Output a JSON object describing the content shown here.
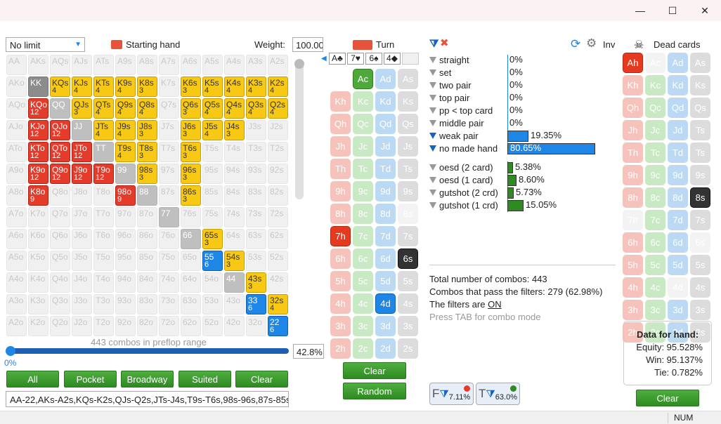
{
  "window": {
    "min": "—",
    "max": "☐",
    "close": "✕"
  },
  "range": {
    "mode_select": "No limit",
    "starting_hand": "Starting hand",
    "weight_label": "Weight:",
    "weight_value": "100.00",
    "combos_text": "443 combos in preflop range",
    "slider_left": "0%",
    "slider_right": "42.8%",
    "range_text": "AA-22,AKs-A2s,KQs-K2s,QJs-Q2s,JTs-J4s,T9s-T6s,98s-96s,87s-85s,7",
    "buttons": [
      "All",
      "Pocket",
      "Broadway",
      "Suited",
      "Clear"
    ]
  },
  "matrix": [
    [
      [
        "AA",
        "",
        "empty"
      ],
      [
        "AKs",
        "",
        "empty"
      ],
      [
        "AQs",
        "",
        "empty"
      ],
      [
        "AJs",
        "",
        "empty"
      ],
      [
        "ATs",
        "",
        "empty"
      ],
      [
        "A9s",
        "",
        "empty"
      ],
      [
        "A8s",
        "",
        "empty"
      ],
      [
        "A7s",
        "",
        "empty"
      ],
      [
        "A6s",
        "",
        "empty"
      ],
      [
        "A5s",
        "",
        "empty"
      ],
      [
        "A4s",
        "",
        "empty"
      ],
      [
        "A3s",
        "",
        "empty"
      ],
      [
        "A2s",
        "",
        "empty"
      ]
    ],
    [
      [
        "AKo",
        "",
        "empty"
      ],
      [
        "KK",
        "",
        "kk"
      ],
      [
        "KQs",
        "4",
        "yel"
      ],
      [
        "KJs",
        "4",
        "yel"
      ],
      [
        "KTs",
        "4",
        "yel"
      ],
      [
        "K9s",
        "4",
        "yel"
      ],
      [
        "K8s",
        "3",
        "yel"
      ],
      [
        "K7s",
        "",
        "empty"
      ],
      [
        "K6s",
        "3",
        "yel"
      ],
      [
        "K5s",
        "4",
        "yel"
      ],
      [
        "K4s",
        "4",
        "yel"
      ],
      [
        "K3s",
        "4",
        "yel"
      ],
      [
        "K2s",
        "4",
        "yel"
      ]
    ],
    [
      [
        "AQo",
        "",
        "empty"
      ],
      [
        "KQo",
        "12",
        "red"
      ],
      [
        "QQ",
        "",
        "pair"
      ],
      [
        "QJs",
        "3",
        "yel"
      ],
      [
        "QTs",
        "4",
        "yel"
      ],
      [
        "Q9s",
        "4",
        "yel"
      ],
      [
        "Q8s",
        "4",
        "yel"
      ],
      [
        "Q7s",
        "",
        "empty"
      ],
      [
        "Q6s",
        "3",
        "yel"
      ],
      [
        "Q5s",
        "4",
        "yel"
      ],
      [
        "Q4s",
        "4",
        "yel"
      ],
      [
        "Q3s",
        "4",
        "yel"
      ],
      [
        "Q2s",
        "4",
        "yel"
      ]
    ],
    [
      [
        "AJo",
        "",
        "empty"
      ],
      [
        "KJo",
        "12",
        "red"
      ],
      [
        "QJo",
        "12",
        "red"
      ],
      [
        "JJ",
        "",
        "pair"
      ],
      [
        "JTs",
        "4",
        "yel"
      ],
      [
        "J9s",
        "4",
        "yel"
      ],
      [
        "J8s",
        "3",
        "yel"
      ],
      [
        "J7s",
        "",
        "empty"
      ],
      [
        "J6s",
        "3",
        "yel"
      ],
      [
        "J5s",
        "4",
        "yel"
      ],
      [
        "J4s",
        "3",
        "yel"
      ],
      [
        "J3s",
        "",
        "empty"
      ],
      [
        "J2s",
        "",
        "empty"
      ]
    ],
    [
      [
        "ATo",
        "",
        "empty"
      ],
      [
        "KTo",
        "12",
        "red"
      ],
      [
        "QTo",
        "12",
        "red"
      ],
      [
        "JTo",
        "12",
        "red"
      ],
      [
        "TT",
        "",
        "pair"
      ],
      [
        "T9s",
        "4",
        "yel"
      ],
      [
        "T8s",
        "3",
        "yel"
      ],
      [
        "T7s",
        "",
        "empty"
      ],
      [
        "T6s",
        "3",
        "yel"
      ],
      [
        "T5s",
        "",
        "empty"
      ],
      [
        "T4s",
        "",
        "empty"
      ],
      [
        "T3s",
        "",
        "empty"
      ],
      [
        "T2s",
        "",
        "empty"
      ]
    ],
    [
      [
        "A9o",
        "",
        "empty"
      ],
      [
        "K9o",
        "12",
        "red"
      ],
      [
        "Q9o",
        "12",
        "red"
      ],
      [
        "J9o",
        "12",
        "red"
      ],
      [
        "T9o",
        "12",
        "red"
      ],
      [
        "99",
        "",
        "pair"
      ],
      [
        "98s",
        "3",
        "yel"
      ],
      [
        "97s",
        "",
        "empty"
      ],
      [
        "96s",
        "3",
        "yel"
      ],
      [
        "95s",
        "",
        "empty"
      ],
      [
        "94s",
        "",
        "empty"
      ],
      [
        "93s",
        "",
        "empty"
      ],
      [
        "92s",
        "",
        "empty"
      ]
    ],
    [
      [
        "A8o",
        "",
        "empty"
      ],
      [
        "K8o",
        "9",
        "red"
      ],
      [
        "Q8o",
        "",
        "empty"
      ],
      [
        "J8o",
        "",
        "empty"
      ],
      [
        "T8o",
        "",
        "empty"
      ],
      [
        "98o",
        "9",
        "red"
      ],
      [
        "88",
        "",
        "pair"
      ],
      [
        "87s",
        "",
        "empty"
      ],
      [
        "86s",
        "3",
        "yel"
      ],
      [
        "85s",
        "",
        "empty"
      ],
      [
        "84s",
        "",
        "empty"
      ],
      [
        "83s",
        "",
        "empty"
      ],
      [
        "82s",
        "",
        "empty"
      ]
    ],
    [
      [
        "A7o",
        "",
        "empty"
      ],
      [
        "K7o",
        "",
        "empty"
      ],
      [
        "Q7o",
        "",
        "empty"
      ],
      [
        "J7o",
        "",
        "empty"
      ],
      [
        "T7o",
        "",
        "empty"
      ],
      [
        "97o",
        "",
        "empty"
      ],
      [
        "87o",
        "",
        "empty"
      ],
      [
        "77",
        "",
        "pair"
      ],
      [
        "76s",
        "",
        "empty"
      ],
      [
        "75s",
        "",
        "empty"
      ],
      [
        "74s",
        "",
        "empty"
      ],
      [
        "73s",
        "",
        "empty"
      ],
      [
        "72s",
        "",
        "empty"
      ]
    ],
    [
      [
        "A6o",
        "",
        "empty"
      ],
      [
        "K6o",
        "",
        "empty"
      ],
      [
        "Q6o",
        "",
        "empty"
      ],
      [
        "J6o",
        "",
        "empty"
      ],
      [
        "T6o",
        "",
        "empty"
      ],
      [
        "96o",
        "",
        "empty"
      ],
      [
        "86o",
        "",
        "empty"
      ],
      [
        "76o",
        "",
        "empty"
      ],
      [
        "66",
        "",
        "pair"
      ],
      [
        "65s",
        "3",
        "yel"
      ],
      [
        "64s",
        "",
        "empty"
      ],
      [
        "63s",
        "",
        "empty"
      ],
      [
        "62s",
        "",
        "empty"
      ]
    ],
    [
      [
        "A5o",
        "",
        "empty"
      ],
      [
        "K5o",
        "",
        "empty"
      ],
      [
        "Q5o",
        "",
        "empty"
      ],
      [
        "J5o",
        "",
        "empty"
      ],
      [
        "T5o",
        "",
        "empty"
      ],
      [
        "95o",
        "",
        "empty"
      ],
      [
        "85o",
        "",
        "empty"
      ],
      [
        "75o",
        "",
        "empty"
      ],
      [
        "65o",
        "",
        "empty"
      ],
      [
        "55",
        "6",
        "blu"
      ],
      [
        "54s",
        "3",
        "yel"
      ],
      [
        "53s",
        "",
        "empty"
      ],
      [
        "52s",
        "",
        "empty"
      ]
    ],
    [
      [
        "A4o",
        "",
        "empty"
      ],
      [
        "K4o",
        "",
        "empty"
      ],
      [
        "Q4o",
        "",
        "empty"
      ],
      [
        "J4o",
        "",
        "empty"
      ],
      [
        "T4o",
        "",
        "empty"
      ],
      [
        "94o",
        "",
        "empty"
      ],
      [
        "84o",
        "",
        "empty"
      ],
      [
        "74o",
        "",
        "empty"
      ],
      [
        "64o",
        "",
        "empty"
      ],
      [
        "54o",
        "",
        "empty"
      ],
      [
        "44",
        "",
        "pair"
      ],
      [
        "43s",
        "3",
        "yel"
      ],
      [
        "42s",
        "",
        "empty"
      ]
    ],
    [
      [
        "A3o",
        "",
        "empty"
      ],
      [
        "K3o",
        "",
        "empty"
      ],
      [
        "Q3o",
        "",
        "empty"
      ],
      [
        "J3o",
        "",
        "empty"
      ],
      [
        "T3o",
        "",
        "empty"
      ],
      [
        "93o",
        "",
        "empty"
      ],
      [
        "83o",
        "",
        "empty"
      ],
      [
        "73o",
        "",
        "empty"
      ],
      [
        "63o",
        "",
        "empty"
      ],
      [
        "53o",
        "",
        "empty"
      ],
      [
        "43o",
        "",
        "empty"
      ],
      [
        "33",
        "6",
        "blu"
      ],
      [
        "32s",
        "4",
        "yel"
      ]
    ],
    [
      [
        "A2o",
        "",
        "empty"
      ],
      [
        "K2o",
        "",
        "empty"
      ],
      [
        "Q2o",
        "",
        "empty"
      ],
      [
        "J2o",
        "",
        "empty"
      ],
      [
        "T2o",
        "",
        "empty"
      ],
      [
        "92o",
        "",
        "empty"
      ],
      [
        "82o",
        "",
        "empty"
      ],
      [
        "72o",
        "",
        "empty"
      ],
      [
        "62o",
        "",
        "empty"
      ],
      [
        "52o",
        "",
        "empty"
      ],
      [
        "42o",
        "",
        "empty"
      ],
      [
        "32o",
        "",
        "empty"
      ],
      [
        "22",
        "6",
        "blu"
      ]
    ]
  ],
  "turn": {
    "label": "Turn",
    "board": [
      "A♣",
      "7♥",
      "6♠",
      "4◆"
    ],
    "clear": "Clear",
    "random": "Random",
    "cols": [
      [
        [
          "",
          "ghost"
        ],
        [
          "Kh",
          "h"
        ],
        [
          "Qh",
          "h"
        ],
        [
          "Jh",
          "h"
        ],
        [
          "Th",
          "h"
        ],
        [
          "9h",
          "h"
        ],
        [
          "8h",
          "h"
        ],
        [
          "7h",
          "sel-h"
        ],
        [
          "6h",
          "h"
        ],
        [
          "5h",
          "h"
        ],
        [
          "4h",
          "h"
        ],
        [
          "3h",
          "h"
        ],
        [
          "2h",
          "h"
        ]
      ],
      [
        [
          "Ac",
          "sel-c"
        ],
        [
          "Kc",
          "c"
        ],
        [
          "Qc",
          "c"
        ],
        [
          "Jc",
          "c"
        ],
        [
          "Tc",
          "c"
        ],
        [
          "9c",
          "c"
        ],
        [
          "8c",
          "c"
        ],
        [
          "7c",
          "c"
        ],
        [
          "6c",
          "c"
        ],
        [
          "5c",
          "c"
        ],
        [
          "4c",
          "c"
        ],
        [
          "3c",
          "c"
        ],
        [
          "2c",
          "c"
        ]
      ],
      [
        [
          "Ad",
          "d"
        ],
        [
          "Kd",
          "d"
        ],
        [
          "Qd",
          "d"
        ],
        [
          "Jd",
          "d"
        ],
        [
          "Td",
          "d"
        ],
        [
          "9d",
          "d"
        ],
        [
          "8d",
          "d"
        ],
        [
          "7d",
          "d"
        ],
        [
          "6d",
          "d"
        ],
        [
          "5d",
          "d"
        ],
        [
          "4d",
          "sel-d"
        ],
        [
          "3d",
          "d"
        ],
        [
          "2d",
          "d"
        ]
      ],
      [
        [
          "As",
          "s"
        ],
        [
          "Ks",
          "s"
        ],
        [
          "Qs",
          "s"
        ],
        [
          "Js",
          "s"
        ],
        [
          "Ts",
          "s"
        ],
        [
          "9s",
          "s"
        ],
        [
          "8s",
          "ghost"
        ],
        [
          "7s",
          "s"
        ],
        [
          "6s",
          "sel-s"
        ],
        [
          "5s",
          "s"
        ],
        [
          "4s",
          "s"
        ],
        [
          "3s",
          "s"
        ],
        [
          "2s",
          "s"
        ]
      ]
    ]
  },
  "filters": {
    "made": [
      [
        "straight",
        "0%",
        0
      ],
      [
        "set",
        "0%",
        0
      ],
      [
        "two pair",
        "0%",
        0
      ],
      [
        "top pair",
        "0%",
        0
      ],
      [
        "pp < top card",
        "0%",
        0
      ],
      [
        "middle pair",
        "0%",
        0
      ],
      [
        "weak pair",
        "19.35%",
        19.35
      ],
      [
        "no made hand",
        "80.65%",
        80.65
      ]
    ],
    "draws": [
      [
        "oesd (2 card)",
        "5.38%",
        5.38
      ],
      [
        "oesd (1 card)",
        "8.60%",
        8.6
      ],
      [
        "gutshot (2 crd)",
        "5.73%",
        5.73
      ],
      [
        "gutshot (1 crd)",
        "15.05%",
        15.05
      ]
    ],
    "made_on": [
      6,
      7
    ],
    "inv": "Inv",
    "stats": [
      "Total number of combos: 443",
      "Combos that pass the filters: 279 (62.98%)",
      "The filters are ",
      "ON",
      "Press TAB for combo mode"
    ],
    "f_btn": "7.11%",
    "t_btn": "63.0%"
  },
  "dead": {
    "label": "Dead cards",
    "clear": "Clear",
    "cols": [
      [
        [
          "Ah",
          "sel-h"
        ],
        [
          "Kh",
          "h"
        ],
        [
          "Qh",
          "h"
        ],
        [
          "Jh",
          "h"
        ],
        [
          "Th",
          "h"
        ],
        [
          "9h",
          "h"
        ],
        [
          "8h",
          "h"
        ],
        [
          "7h",
          "ghost"
        ],
        [
          "6h",
          "h"
        ],
        [
          "5h",
          "h"
        ],
        [
          "4h",
          "h"
        ],
        [
          "3h",
          "h"
        ],
        [
          "2h",
          "h"
        ]
      ],
      [
        [
          "Ac",
          "ghost"
        ],
        [
          "Kc",
          "c"
        ],
        [
          "Qc",
          "c"
        ],
        [
          "Jc",
          "c"
        ],
        [
          "Tc",
          "c"
        ],
        [
          "9c",
          "c"
        ],
        [
          "8c",
          "c"
        ],
        [
          "7c",
          "c"
        ],
        [
          "6c",
          "c"
        ],
        [
          "5c",
          "c"
        ],
        [
          "4c",
          "c"
        ],
        [
          "3c",
          "c"
        ],
        [
          "2c",
          "c"
        ]
      ],
      [
        [
          "Ad",
          "d"
        ],
        [
          "Kd",
          "d"
        ],
        [
          "Qd",
          "d"
        ],
        [
          "Jd",
          "d"
        ],
        [
          "Td",
          "d"
        ],
        [
          "9d",
          "d"
        ],
        [
          "8d",
          "d"
        ],
        [
          "7d",
          "d"
        ],
        [
          "6d",
          "d"
        ],
        [
          "5d",
          "d"
        ],
        [
          "4d",
          "ghost"
        ],
        [
          "3d",
          "d"
        ],
        [
          "2d",
          "d"
        ]
      ],
      [
        [
          "As",
          "s"
        ],
        [
          "Ks",
          "s"
        ],
        [
          "Qs",
          "s"
        ],
        [
          "Ts",
          "s"
        ],
        [
          "Ts",
          "s"
        ],
        [
          "9s",
          "s"
        ],
        [
          "8s",
          "sel-s"
        ],
        [
          "7s",
          "s"
        ],
        [
          "6s",
          "ghost"
        ],
        [
          "5s",
          "s"
        ],
        [
          "4s",
          "s"
        ],
        [
          "3s",
          "s"
        ],
        [
          "2s",
          "s"
        ]
      ]
    ],
    "hand_title": "Data for hand:",
    "equity": "Equity: 95.528%",
    "win": "Win: 95.137%",
    "tie": "Tie: 0.782%"
  },
  "status": {
    "num": "NUM"
  }
}
